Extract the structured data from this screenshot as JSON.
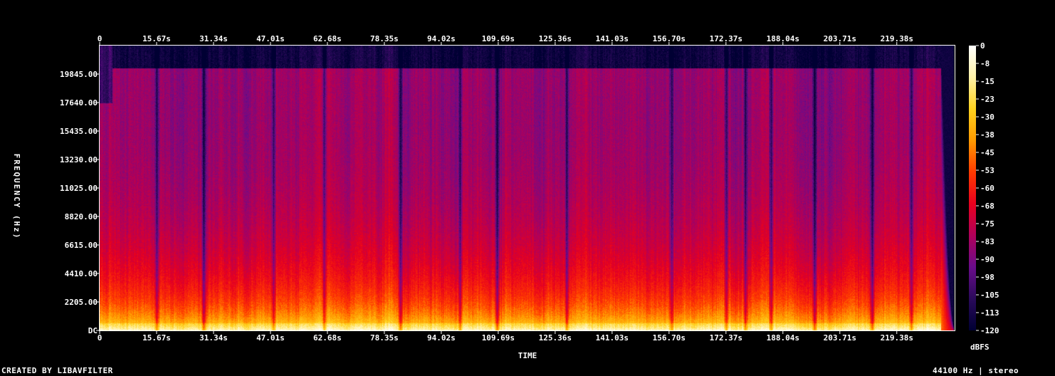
{
  "chart_data": {
    "type": "heatmap",
    "xlabel": "TIME",
    "ylabel": "FREQUENCY (Hz)",
    "x_ticks": [
      "0",
      "15.67s",
      "31.34s",
      "47.01s",
      "62.68s",
      "78.35s",
      "94.02s",
      "109.69s",
      "125.36s",
      "141.03s",
      "156.70s",
      "172.37s",
      "188.04s",
      "203.71s",
      "219.38s"
    ],
    "x_tick_step_seconds": 15.67,
    "x_range_seconds": [
      0,
      235.1
    ],
    "y_ticks": [
      "DC",
      "2205.00",
      "4410.00",
      "6615.00",
      "8820.00",
      "11025.00",
      "13230.00",
      "15435.00",
      "17640.00",
      "19845.00"
    ],
    "y_tick_step_hz": 2205,
    "y_range_hz": [
      0,
      22050
    ],
    "colorbar": {
      "label": "dBFS",
      "ticks": [
        "0",
        "-8",
        "-15",
        "-23",
        "-30",
        "-38",
        "-45",
        "-53",
        "-60",
        "-68",
        "-75",
        "-83",
        "-90",
        "-98",
        "-105",
        "-113",
        "-120"
      ],
      "range_db": [
        -120,
        0
      ],
      "colors": [
        "#ffffff",
        "#fff2a8",
        "#ffd21e",
        "#ff9a00",
        "#ff3a00",
        "#e8001e",
        "#b0005a",
        "#6a0c8a",
        "#2a0a5a",
        "#000033"
      ]
    },
    "features": {
      "active_range_seconds": [
        3.5,
        231.5
      ],
      "fade_out_seconds": [
        231.5,
        235.1
      ],
      "intro_cutoff_hz": 17600,
      "main_cutoff_hz": 20300,
      "dips_seconds": [
        15.7,
        28.6,
        47.9,
        61.8,
        82.6,
        99.2,
        109.4,
        128.6,
        157.4,
        172.5,
        177.6,
        184.8,
        196.7,
        212.5,
        223.4
      ]
    }
  },
  "footer": {
    "left": "CREATED BY LIBAVFILTER",
    "right": "44100 Hz | stereo"
  }
}
